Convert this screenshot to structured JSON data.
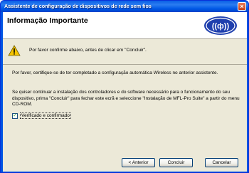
{
  "window": {
    "title": "Assistente de configuração de dispositivos de rede sem fios"
  },
  "header": {
    "title": "Informação Importante",
    "logo_icon": "wireless-logo-icon"
  },
  "warning": {
    "icon": "warning-icon",
    "text": "Por favor confirme abaixo, antes de clicar em \"Concluir\"."
  },
  "body": {
    "paragraph1": "Por favor, certifique-se de ter completado a configuração automática Wireless no anterior assistente.",
    "paragraph2": "Se quiser continuar a instalação dos controladores e do software necessário para o funcionamento do seu dispositivo, prima \"Concluir\" para fechar este ecrã e seleccione \"Instalação de MFL-Pro Suite\" a partir do menu CD-ROM."
  },
  "checkbox": {
    "label": "Verificado e confirmado",
    "checked": true
  },
  "buttons": {
    "previous": "< Anterior",
    "finish": "Concluir",
    "cancel": "Cancelar"
  },
  "colors": {
    "titlebar": "#0054e3",
    "dialog_bg": "#ece9d8",
    "header_bg": "#ffffff"
  }
}
